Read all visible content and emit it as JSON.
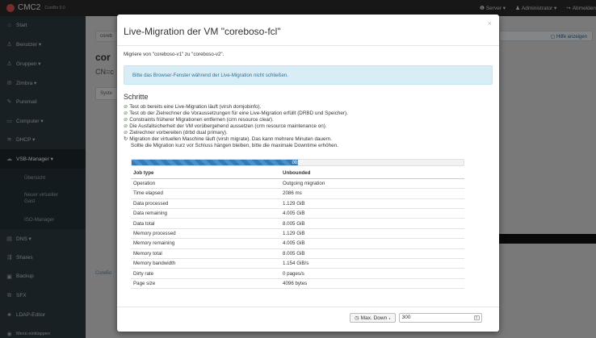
{
  "topbar": {
    "brand": "CMC2",
    "version": "CoreBo 9.0",
    "server": "Server",
    "admin": "Administrator",
    "logout": "Abmelden"
  },
  "sidebar": {
    "items": [
      {
        "label": "Start",
        "icon": "home-icon"
      },
      {
        "label": "Benutzer ▾",
        "icon": "user-icon"
      },
      {
        "label": "Gruppen ▾",
        "icon": "group-icon"
      },
      {
        "label": "Zimbra ▾",
        "icon": "mail-icon"
      },
      {
        "label": "Puremail",
        "icon": "mail-icon"
      },
      {
        "label": "Computer ▾",
        "icon": "computer-icon"
      },
      {
        "label": "DHCP ▾",
        "icon": "network-icon"
      },
      {
        "label": "VSB-Manager ▾",
        "icon": "cloud-icon"
      },
      {
        "label": "DNS ▾",
        "icon": "dns-icon"
      },
      {
        "label": "Shares",
        "icon": "share-icon"
      },
      {
        "label": "Backup",
        "icon": "backup-icon"
      },
      {
        "label": "SFX",
        "icon": "sfx-icon"
      },
      {
        "label": "LDAP-Editor",
        "icon": "tree-icon"
      },
      {
        "label": "Menü einklappen",
        "icon": "collapse-icon"
      }
    ],
    "sub": [
      "Übersicht",
      "Neuer virtueller Gast",
      "ISO-Manager"
    ]
  },
  "background": {
    "breadcrumb": "coreb",
    "title": "cor",
    "cn": "CN=c",
    "tab": "Syste",
    "footer_link": "CoreBo",
    "help": "Hilfe anzeigen"
  },
  "modal": {
    "title": "Live-Migration der VM \"coreboso-fcl\"",
    "close": "×",
    "from_to": "Migriere von \"coreboso-v1\" zu \"coreboso-v2\".",
    "alert": "Bitte das Browser-Fenster während der Live-Migration nicht schließen.",
    "steps_heading": "Schritte",
    "steps": [
      {
        "text": "Test ob bereits eine Live-Migration läuft (virsh domjobinfo).",
        "done": true
      },
      {
        "text": "Test ob der Zielrechner die Voraussetzungen für eine Live-Migration erfüllt (DRBD und Speicher).",
        "done": true
      },
      {
        "text": "Constraints früherer Migrationen entfernen (crm resource clear).",
        "done": true
      },
      {
        "text": "Die Ausfallsicherheit der VM vorübergehend aussetzen (crm resource maintenance on).",
        "done": true
      },
      {
        "text": "Zielrechner vorbereiten (drbd dual primary).",
        "done": true
      },
      {
        "text": "Migration der virtuellen Maschine läuft (virsh migrate). Das kann mehrere Minuten dauern.",
        "done": false
      }
    ],
    "step_note": "Sollte die Migration kurz vor Schluss hängen bleiben, bitte die maximale Downtime erhöhen.",
    "progress": {
      "label": "00:07",
      "percent": 50
    },
    "table": {
      "header": [
        "Job type",
        "Unbounded"
      ],
      "rows": [
        [
          "Operation",
          "Outgoing migration"
        ],
        [
          "Time elapsed",
          "2086 ms"
        ],
        [
          "Data processed",
          "1.129 GiB"
        ],
        [
          "Data remaining",
          "4.005 GiB"
        ],
        [
          "Data total",
          "8.005 GiB"
        ],
        [
          "Memory processed",
          "1.129 GiB"
        ],
        [
          "Memory remaining",
          "4.005 GiB"
        ],
        [
          "Memory total",
          "8.005 GiB"
        ],
        [
          "Memory bandwidth",
          "1.154 GiB/s"
        ],
        [
          "Dirty rate",
          "0 pages/s"
        ],
        [
          "Page size",
          "4096 bytes"
        ]
      ]
    },
    "footer": {
      "max_down_label": "Max. Down",
      "max_down_value": "300"
    }
  }
}
